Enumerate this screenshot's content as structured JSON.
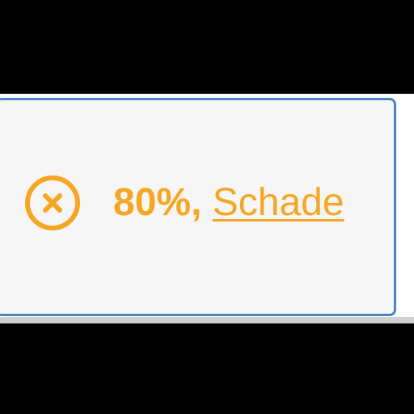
{
  "status": {
    "percent": "80%,",
    "link_label": "Schade",
    "icon": "close-circle-icon",
    "accent_color": "#f5a623",
    "border_color": "#4a86c5"
  }
}
